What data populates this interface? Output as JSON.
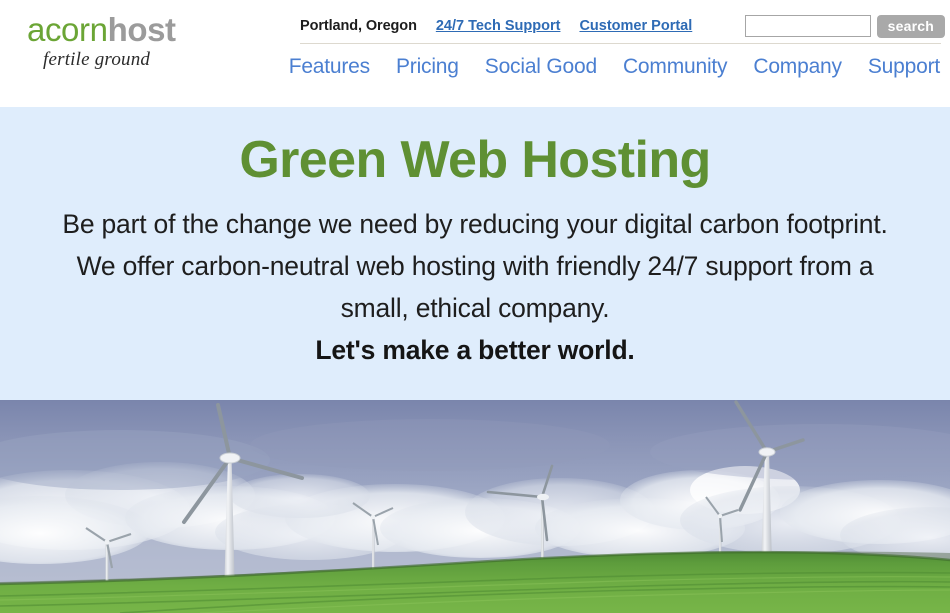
{
  "brand": {
    "logo_primary": "acorn",
    "logo_secondary": "host",
    "tagline": "fertile ground",
    "green": "#6ba535",
    "gray": "#9b9b9b"
  },
  "utility": {
    "location": "Portland, Oregon",
    "links": [
      {
        "label": "24/7 Tech Support"
      },
      {
        "label": "Customer Portal"
      }
    ],
    "search": {
      "value": "",
      "placeholder": "",
      "button_label": "search"
    },
    "link_color": "#2e6bb5"
  },
  "nav": {
    "items": [
      {
        "label": "Features"
      },
      {
        "label": "Pricing"
      },
      {
        "label": "Social Good"
      },
      {
        "label": "Community"
      },
      {
        "label": "Company"
      },
      {
        "label": "Support"
      }
    ],
    "link_color": "#4b7fd1"
  },
  "hero": {
    "title": "Green Web Hosting",
    "title_color": "#5f9033",
    "background_color": "#dfedfc",
    "paragraph": "Be part of the change we need by reducing your digital carbon footprint. We offer carbon-neutral web hosting with friendly 24/7 support from a small, ethical company.",
    "tagline": "Let's make a better world.",
    "image_alt": "wind turbines on a green hillside under a cloudy sky"
  }
}
